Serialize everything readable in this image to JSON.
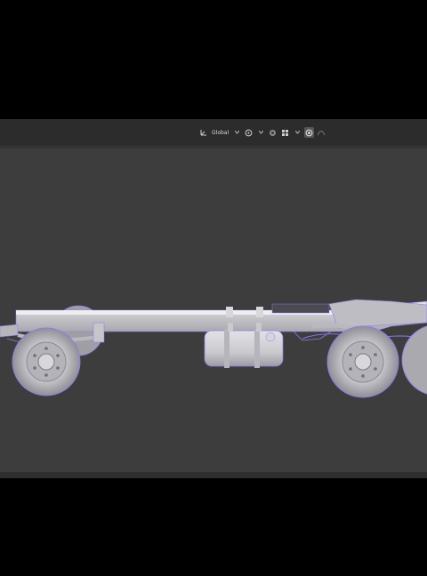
{
  "toolbar": {
    "transform_orientation": "Global",
    "icons": [
      "transform-orientation-icon",
      "chevron-down-icon",
      "pivot-point-icon",
      "chevron-down-icon",
      "snap-toggle-icon",
      "snap-target-icon",
      "chevron-down-icon",
      "proportional-editing-icon",
      "proportional-falloff-icon"
    ]
  },
  "scene": {
    "background": "#3d3d3d",
    "model_color": "#cfcfd4",
    "selection_outline": "#8c7cf2"
  }
}
